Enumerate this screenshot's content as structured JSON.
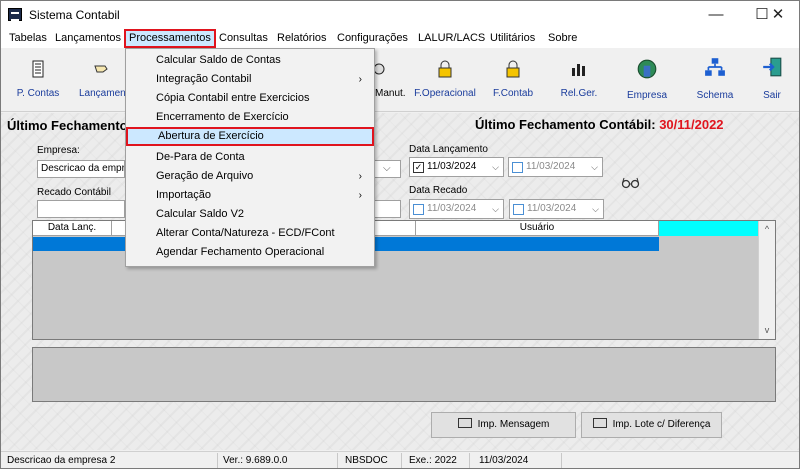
{
  "window": {
    "title": "Sistema Contabil",
    "minimize": "—",
    "maximize": "☐",
    "close": "✕"
  },
  "menubar": [
    "Tabelas",
    "Lançamentos",
    "Processamentos",
    "Consultas",
    "Relatórios",
    "Configurações",
    "LALUR/LACS",
    "Utilitários",
    "Sobre"
  ],
  "toolbar": {
    "p_contas": "P. Contas",
    "lancamento_partial": "Lançamen",
    "manut_partial": "Manut.",
    "f_operacional": "F.Operacional",
    "f_contab": "F.Contab",
    "rel_ger": "Rel.Ger.",
    "empresa": "Empresa",
    "schema": "Schema",
    "sair": "Sair"
  },
  "processamentos_menu": [
    {
      "label": "Calcular Saldo de Contas",
      "submenu": false
    },
    {
      "label": "Integração Contabil",
      "submenu": true
    },
    {
      "label": "Cópia Contabil entre Exercicios",
      "submenu": false
    },
    {
      "label": "Encerramento de Exercício",
      "submenu": false
    },
    {
      "label": "Abertura de Exercício",
      "submenu": false,
      "highlighted": true
    },
    {
      "label": "De-Para de Conta",
      "submenu": false
    },
    {
      "label": "Geração de Arquivo",
      "submenu": true
    },
    {
      "label": "Importação",
      "submenu": true
    },
    {
      "label": "Calcular Saldo V2",
      "submenu": false
    },
    {
      "label": "Alterar Conta/Natureza - ECD/FCont",
      "submenu": false
    },
    {
      "label": "Agendar Fechamento Operacional",
      "submenu": false
    }
  ],
  "submenu_arrow": "›",
  "main": {
    "left_heading": "Último Fechamento",
    "right_heading_label": "Último Fechamento Contábil:",
    "right_heading_date": "30/11/2022",
    "empresa_label": "Empresa:",
    "empresa_value": "Descricao da empre",
    "recado_label": "Recado Contábil",
    "recado_value": "",
    "data_lancamento_label": "Data Lançamento",
    "data_lanc_from": "11/03/2024",
    "data_lanc_to": "11/03/2024",
    "data_recado_label": "Data Recado",
    "data_recado_from": "11/03/2024",
    "data_recado_to": "11/03/2024",
    "check_on": "✓",
    "dd_arrow": "⌵"
  },
  "grid": {
    "col_data_lanc": "Data Lanç.",
    "col_usuario": "Usuário",
    "scroll_up": "^",
    "scroll_down": "v"
  },
  "buttons": {
    "imp_mensagem": "Imp. Mensagem",
    "imp_lote": "Imp. Lote c/ Diferença"
  },
  "status": {
    "empresa": "Descricao da empresa 2",
    "versao": "Ver.: 9.689.0.0",
    "sistema": "NBSDOC",
    "exercicio": "Exe.: 2022",
    "data": "11/03/2024"
  },
  "colors": {
    "highlight_border": "#e0141e",
    "selection": "#0078d7",
    "cyan": "#00ffff",
    "menu_highlight_bg": "#cce8ff"
  }
}
